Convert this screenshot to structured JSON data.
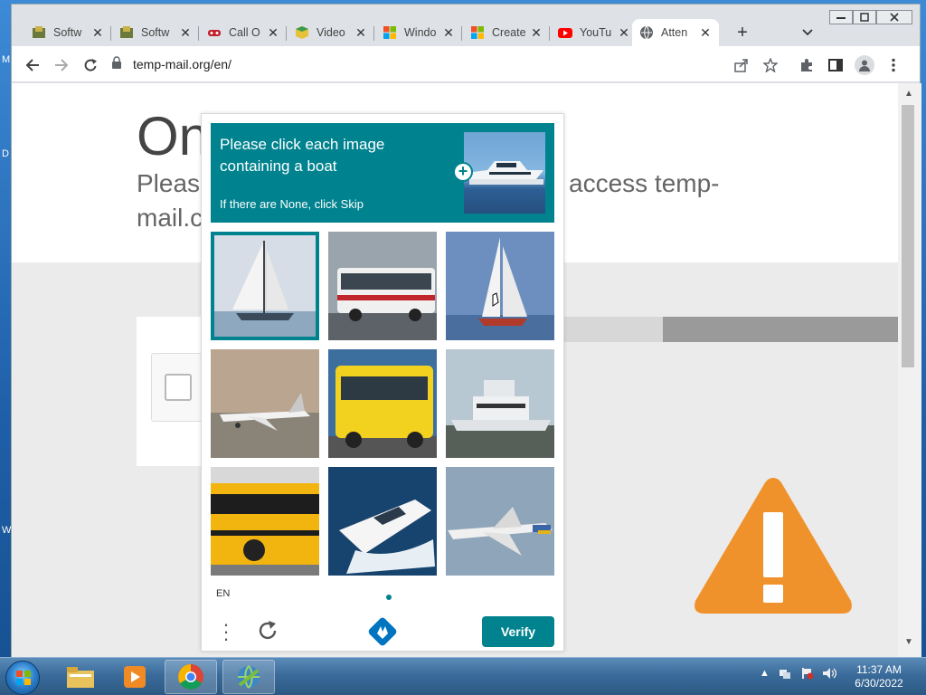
{
  "desktop": {
    "edge_letters": [
      "M",
      "D",
      "W"
    ]
  },
  "browser": {
    "tabs": [
      {
        "title": "Softw",
        "icon": "software-icon",
        "active": false
      },
      {
        "title": "Softw",
        "icon": "software-icon",
        "active": false
      },
      {
        "title": "Call O",
        "icon": "gamepad-icon",
        "active": false
      },
      {
        "title": "Video",
        "icon": "cube-icon",
        "active": false
      },
      {
        "title": "Windo",
        "icon": "windows-logo-icon",
        "active": false
      },
      {
        "title": "Create",
        "icon": "windows-logo-icon",
        "active": false
      },
      {
        "title": "YouTu",
        "icon": "youtube-icon",
        "active": false
      },
      {
        "title": "Atten",
        "icon": "globe-icon",
        "active": true
      }
    ],
    "url": "temp-mail.org/en/"
  },
  "page": {
    "title": "On",
    "subtitle_left": "Please",
    "subtitle_right": "access temp-",
    "subtitle_line2": "mail.c"
  },
  "captcha": {
    "prompt": "Please click each image containing a boat",
    "sub": "If there are None, click Skip",
    "lang": "EN",
    "verify_label": "Verify",
    "accent": "#00838f",
    "tiles": [
      {
        "subject": "sailboat",
        "selected": true
      },
      {
        "subject": "bus",
        "selected": false
      },
      {
        "subject": "sailboat",
        "selected": false
      },
      {
        "subject": "airplane",
        "selected": false
      },
      {
        "subject": "yellow-bus",
        "selected": false
      },
      {
        "subject": "yacht",
        "selected": false
      },
      {
        "subject": "school-bus",
        "selected": false
      },
      {
        "subject": "speedboat",
        "selected": false
      },
      {
        "subject": "airplane",
        "selected": false
      }
    ]
  },
  "taskbar": {
    "time": "11:37 AM",
    "date": "6/30/2022"
  },
  "colors": {
    "warning": "#f0922b"
  }
}
